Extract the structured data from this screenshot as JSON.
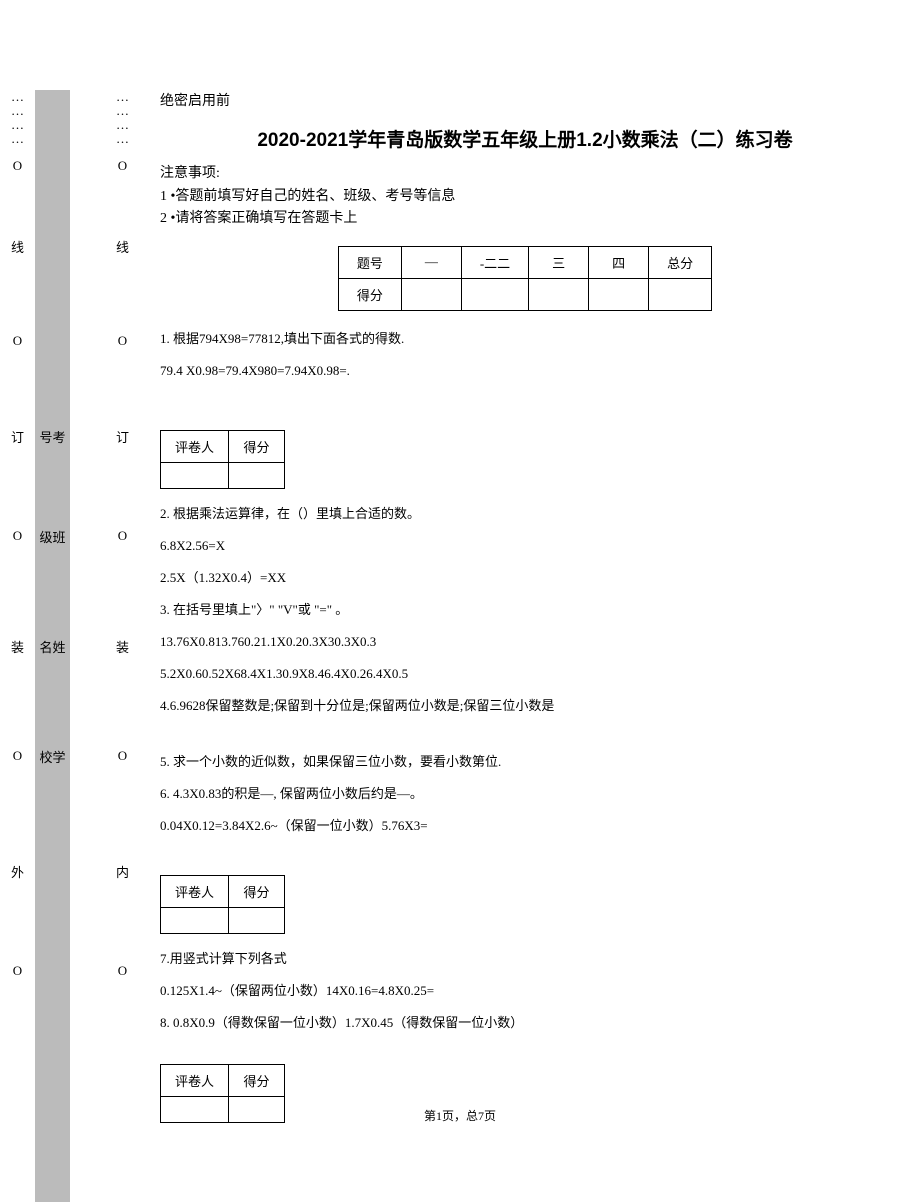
{
  "header": {
    "secret": "绝密启用前",
    "title": "2020-2021学年青岛版数学五年级上册1.2小数乘法（二）练习卷",
    "notice_label": "注意事项:",
    "notice_1": "1 •答题前填写好自己的姓名、班级、考号等信息",
    "notice_2": "2 •请将答案正确填写在答题卡上"
  },
  "score_table": {
    "h0": "题号",
    "h1": "—",
    "h2": "-二二",
    "h3": "三",
    "h4": "四",
    "h5": "总分",
    "r0": "得分"
  },
  "grader": {
    "col1": "评卷人",
    "col2": "得分"
  },
  "questions": {
    "q1a": "1.  根据794X98=77812,填出下面各式的得数.",
    "q1b": "79.4  X0.98=79.4X980=7.94X0.98=.",
    "q2a": "2.  根据乘法运算律，在（）里填上合适的数。",
    "q2b": "6.8X2.56=X",
    "q2c": "2.5X（1.32X0.4）=XX",
    "q3a": "3.  在括号里填上\"〉\" \"V\"或 \"=\" 。",
    "q3b": "13.76X0.813.760.21.1X0.20.3X30.3X0.3",
    "q3c": "5.2X0.60.52X68.4X1.30.9X8.46.4X0.26.4X0.5",
    "q4": "4.6.9628保留整数是;保留到十分位是;保留两位小数是;保留三位小数是",
    "q5": "5.  求一个小数的近似数，如果保留三位小数，要看小数第位.",
    "q6a": "6.  4.3X0.83的积是—,  保留两位小数后约是—。",
    "q6b": "0.04X0.12=3.84X2.6~（保留一位小数）5.76X3=",
    "q7a": " 7.用竖式计算下列各式",
    "q7b": "0.125X1.4~（保留两位小数）14X0.16=4.8X0.25=",
    "q8": "8.  0.8X0.9（得数保留一位小数）1.7X0.45（得数保留一位小数）"
  },
  "gutter": {
    "outer": [
      "…",
      "…",
      "…",
      "…",
      "O",
      "",
      "",
      "线",
      "",
      "",
      "O",
      "",
      "",
      "订",
      "",
      "",
      "O",
      "",
      "",
      "装",
      "",
      "",
      "O",
      "",
      "",
      "外",
      "",
      "",
      "O"
    ],
    "gray": [
      "",
      "",
      "",
      "",
      "",
      "",
      "",
      "",
      "",
      "",
      "",
      "",
      "",
      "号考",
      "",
      "",
      "级班",
      "",
      "",
      "名姓",
      "",
      "",
      "校学",
      "",
      "",
      "",
      "",
      "",
      ""
    ],
    "inner": [
      "…",
      "…",
      "…",
      "…",
      "O",
      "",
      "",
      "线",
      "",
      "",
      "O",
      "",
      "",
      "订",
      "",
      "",
      "O",
      "",
      "",
      "装",
      "",
      "",
      "O",
      "",
      "",
      "内",
      "",
      "",
      "O"
    ]
  },
  "footer": "第1页，总7页"
}
